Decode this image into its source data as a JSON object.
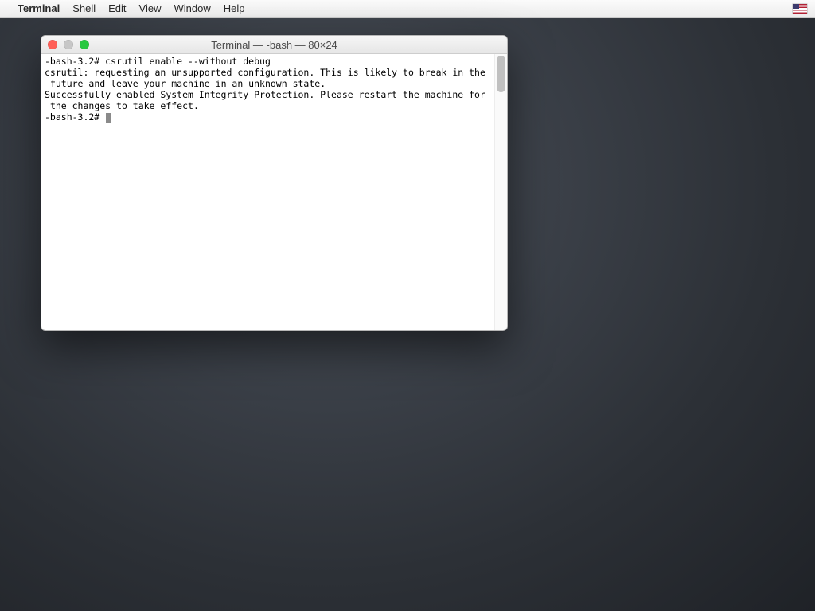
{
  "menubar": {
    "app_name": "Terminal",
    "items": [
      "Shell",
      "Edit",
      "View",
      "Window",
      "Help"
    ]
  },
  "window": {
    "title": "Terminal — -bash — 80×24"
  },
  "terminal": {
    "lines": [
      "-bash-3.2# csrutil enable --without debug",
      "csrutil: requesting an unsupported configuration. This is likely to break in the",
      " future and leave your machine in an unknown state.",
      "Successfully enabled System Integrity Protection. Please restart the machine for",
      " the changes to take effect."
    ],
    "prompt": "-bash-3.2# "
  }
}
